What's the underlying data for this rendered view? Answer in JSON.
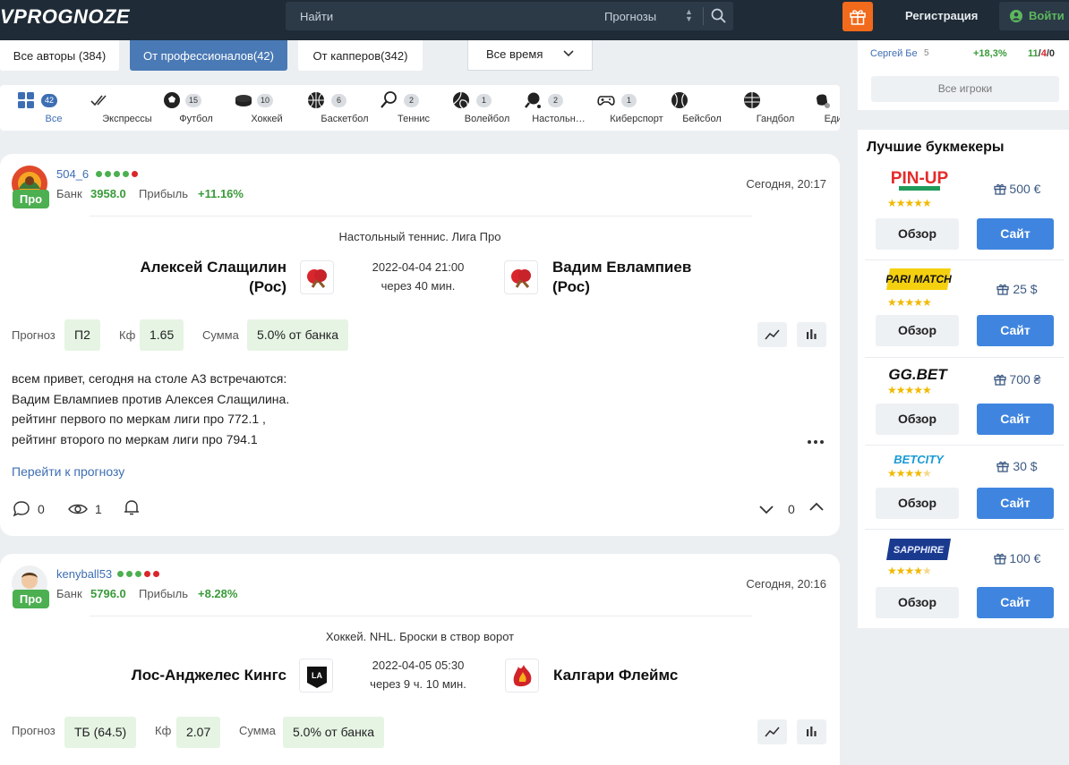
{
  "header": {
    "logo": "VPROGNOZE",
    "search_placeholder": "Найти",
    "search_scope": "Прогнозы",
    "register": "Регистрация",
    "login": "Войти"
  },
  "filters": {
    "all_authors": "Все авторы (384)",
    "pros": "От профессионалов(42)",
    "cappers": "От капперов(342)",
    "period": "Все время"
  },
  "sports": [
    {
      "label": "Все",
      "count": "42",
      "icon": "grid-icon"
    },
    {
      "label": "Экспрессы",
      "count": "",
      "icon": "express-check-icon"
    },
    {
      "label": "Футбол",
      "count": "15",
      "icon": "football-icon"
    },
    {
      "label": "Хоккей",
      "count": "10",
      "icon": "hockey-puck-icon"
    },
    {
      "label": "Баскетбол",
      "count": "6",
      "icon": "basketball-icon"
    },
    {
      "label": "Теннис",
      "count": "2",
      "icon": "tennis-racket-icon"
    },
    {
      "label": "Волейбол",
      "count": "1",
      "icon": "volleyball-icon"
    },
    {
      "label": "Настольн…",
      "count": "2",
      "icon": "table-tennis-icon"
    },
    {
      "label": "Киберспорт",
      "count": "1",
      "icon": "gamepad-icon"
    },
    {
      "label": "Бейсбол",
      "count": "",
      "icon": "baseball-icon"
    },
    {
      "label": "Гандбол",
      "count": "",
      "icon": "handball-icon"
    },
    {
      "label": "Единобор",
      "count": "",
      "icon": "martial-arts-icon"
    }
  ],
  "labels": {
    "bank": "Банк",
    "profit": "Прибыль",
    "prediction": "Прогноз",
    "coef": "Кф",
    "sum": "Сумма",
    "go_to": "Перейти к прогнозу"
  },
  "colors": {
    "accent": "#3d6eb3",
    "success": "#4caf50",
    "header": "#1f2b37",
    "gift": "#f26a1b"
  },
  "posts": [
    {
      "author": "504_6",
      "badge": "Про",
      "bank": "3958.0",
      "profit": "+11.16%",
      "date": "Сегодня, 20:17",
      "dots": [
        "#4caf50",
        "#4caf50",
        "#4caf50",
        "#4caf50",
        "#d9262c"
      ],
      "league": "Настольный теннис. Лига Про",
      "team1_line1": "Алексей Слащилин",
      "team1_line2": "(Рос)",
      "team2_line1": "Вадим Евлампиев",
      "team2_line2": "(Рос)",
      "match_date": "2022-04-04 21:00",
      "countdown": "через 40 мин.",
      "prediction": "П2",
      "coef": "1.65",
      "sum": "5.0% от банка",
      "text": [
        "всем привет, сегодня на столе А3 встречаются:",
        "Вадим Евлампиев против Алексея Слащилина.",
        "рейтинг первого по меркам лиги про 772.1 ,",
        "рейтинг второго по меркам лиги про 794.1"
      ],
      "comments": "0",
      "views": "1",
      "votes": "0"
    },
    {
      "author": "kenyball53",
      "badge": "Про",
      "bank": "5796.0",
      "profit": "+8.28%",
      "date": "Сегодня, 20:16",
      "dots": [
        "#4caf50",
        "#4caf50",
        "#4caf50",
        "#d9262c",
        "#d9262c"
      ],
      "league": "Хоккей. NHL. Броски в створ ворот",
      "team1_line1": "Лос-Анджелес Кингс",
      "team2_line1": "Калгари Флеймс",
      "match_date": "2022-04-05 05:30",
      "countdown": "через 9 ч. 10 мин.",
      "prediction": "ТБ (64.5)",
      "coef": "2.07",
      "sum": "5.0% от банка"
    }
  ],
  "top_player": {
    "name": "Сергей Бе",
    "rank": "5",
    "roi": "+18,3%",
    "wins": "11",
    "losses": "4",
    "draws": "0",
    "all_players": "Все игроки"
  },
  "bookmakers": {
    "title": "Лучшие букмекеры",
    "review": "Обзор",
    "site": "Сайт",
    "items": [
      {
        "name": "PIN-UP",
        "bonus": "500 €",
        "rating": 5
      },
      {
        "name": "PARI MATCH",
        "bonus": "25 $",
        "rating": 5
      },
      {
        "name": "GG.BET",
        "bonus": "700 ₴",
        "rating": 5
      },
      {
        "name": "BETCITY",
        "bonus": "30 $",
        "rating": 4.5
      },
      {
        "name": "SAPPHIRE",
        "bonus": "100 €",
        "rating": 4.5
      }
    ]
  }
}
